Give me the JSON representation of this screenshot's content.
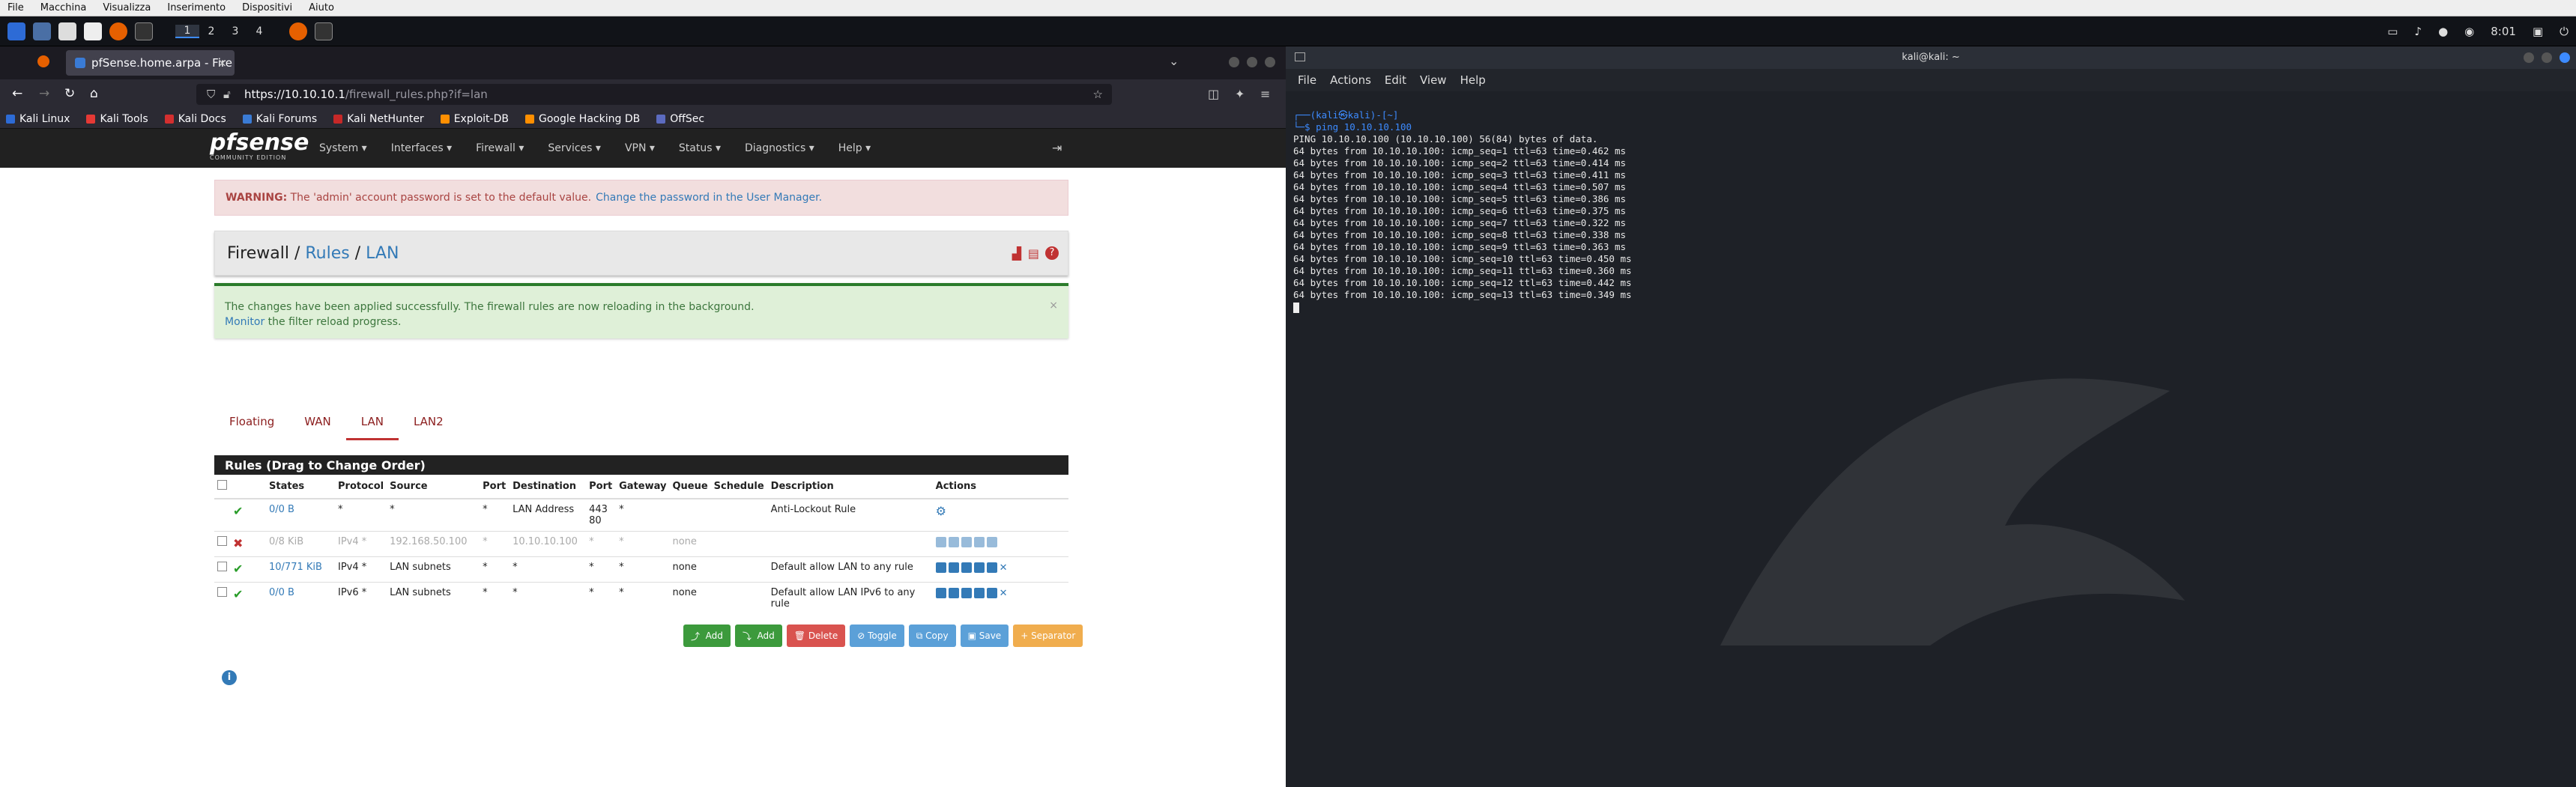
{
  "vm_menu": [
    "File",
    "Macchina",
    "Visualizza",
    "Inserimento",
    "Dispositivi",
    "Aiuto"
  ],
  "panel": {
    "workspaces": [
      "1",
      "2",
      "3",
      "4"
    ],
    "clock": "8:01"
  },
  "browser": {
    "tab_title": "pfSense.home.arpa - Fire",
    "url_host": "https://10.10.10.1",
    "url_path": "/firewall_rules.php?if=lan",
    "bookmarks": [
      "Kali Linux",
      "Kali Tools",
      "Kali Docs",
      "Kali Forums",
      "Kali NetHunter",
      "Exploit-DB",
      "Google Hacking DB",
      "OffSec"
    ]
  },
  "pf": {
    "logo": "sense",
    "logo_pf": "pf",
    "logo_sub": "COMMUNITY EDITION",
    "menu": [
      "System ▾",
      "Interfaces ▾",
      "Firewall ▾",
      "Services ▾",
      "VPN ▾",
      "Status ▾",
      "Diagnostics ▾",
      "Help ▾"
    ],
    "warning_label": "WARNING:",
    "warning_text": "The 'admin' account password is set to the default value.",
    "warning_link": "Change the password in the User Manager.",
    "bread_1": "Firewall",
    "bread_2": "Rules",
    "bread_3": "LAN",
    "success_text": "The changes have been applied successfully. The firewall rules are now reloading in the background.",
    "success_link": "Monitor",
    "success_tail": " the filter reload progress.",
    "tabs": [
      "Floating",
      "WAN",
      "LAN",
      "LAN2"
    ],
    "table_title": "Rules (Drag to Change Order)",
    "columns": [
      "",
      "",
      "States",
      "Protocol",
      "Source",
      "Port",
      "Destination",
      "Port",
      "Gateway",
      "Queue",
      "Schedule",
      "Description",
      "Actions"
    ],
    "rows": [
      {
        "status": "✔",
        "states": "0/0 B",
        "protocol": "*",
        "source": "*",
        "sport": "*",
        "dest": "LAN Address",
        "dport": "443\n80",
        "gateway": "*",
        "queue": "",
        "schedule": "",
        "desc": "Anti-Lockout Rule"
      },
      {
        "status": "✖",
        "states": "0/8 KiB",
        "protocol": "IPv4 *",
        "source": "192.168.50.100",
        "sport": "*",
        "dest": "10.10.10.100",
        "dport": "*",
        "gateway": "*",
        "queue": "none",
        "schedule": "",
        "desc": ""
      },
      {
        "status": "✔",
        "states": "10/771 KiB",
        "protocol": "IPv4 *",
        "source": "LAN subnets",
        "sport": "*",
        "dest": "*",
        "dport": "*",
        "gateway": "*",
        "queue": "none",
        "schedule": "",
        "desc": "Default allow LAN to any rule"
      },
      {
        "status": "✔",
        "states": "0/0 B",
        "protocol": "IPv6 *",
        "source": "LAN subnets",
        "sport": "*",
        "dest": "*",
        "dport": "*",
        "gateway": "*",
        "queue": "none",
        "schedule": "",
        "desc": "Default allow LAN IPv6 to any rule"
      }
    ],
    "buttons": [
      {
        "label": "Add",
        "color": "#3c9a3c"
      },
      {
        "label": "Add",
        "color": "#3c9a3c"
      },
      {
        "label": "Delete",
        "color": "#d9534f"
      },
      {
        "label": "Toggle",
        "color": "#5ba0d8"
      },
      {
        "label": "Copy",
        "color": "#5ba0d8"
      },
      {
        "label": "Save",
        "color": "#5ba0d8"
      },
      {
        "label": "Separator",
        "color": "#f0ad4e"
      }
    ]
  },
  "terminal": {
    "title": "kali@kali: ~",
    "menu": [
      "File",
      "Actions",
      "Edit",
      "View",
      "Help"
    ],
    "prompt_top": "┌──(kali㉿kali)-[~]",
    "prompt_cmd": "└─$ ping 10.10.10.100",
    "lines": [
      "PING 10.10.10.100 (10.10.10.100) 56(84) bytes of data.",
      "64 bytes from 10.10.10.100: icmp_seq=1 ttl=63 time=0.462 ms",
      "64 bytes from 10.10.10.100: icmp_seq=2 ttl=63 time=0.414 ms",
      "64 bytes from 10.10.10.100: icmp_seq=3 ttl=63 time=0.411 ms",
      "64 bytes from 10.10.10.100: icmp_seq=4 ttl=63 time=0.507 ms",
      "64 bytes from 10.10.10.100: icmp_seq=5 ttl=63 time=0.386 ms",
      "64 bytes from 10.10.10.100: icmp_seq=6 ttl=63 time=0.375 ms",
      "64 bytes from 10.10.10.100: icmp_seq=7 ttl=63 time=0.322 ms",
      "64 bytes from 10.10.10.100: icmp_seq=8 ttl=63 time=0.338 ms",
      "64 bytes from 10.10.10.100: icmp_seq=9 ttl=63 time=0.363 ms",
      "64 bytes from 10.10.10.100: icmp_seq=10 ttl=63 time=0.450 ms",
      "64 bytes from 10.10.10.100: icmp_seq=11 ttl=63 time=0.360 ms",
      "64 bytes from 10.10.10.100: icmp_seq=12 ttl=63 time=0.442 ms",
      "64 bytes from 10.10.10.100: icmp_seq=13 ttl=63 time=0.349 ms"
    ]
  }
}
